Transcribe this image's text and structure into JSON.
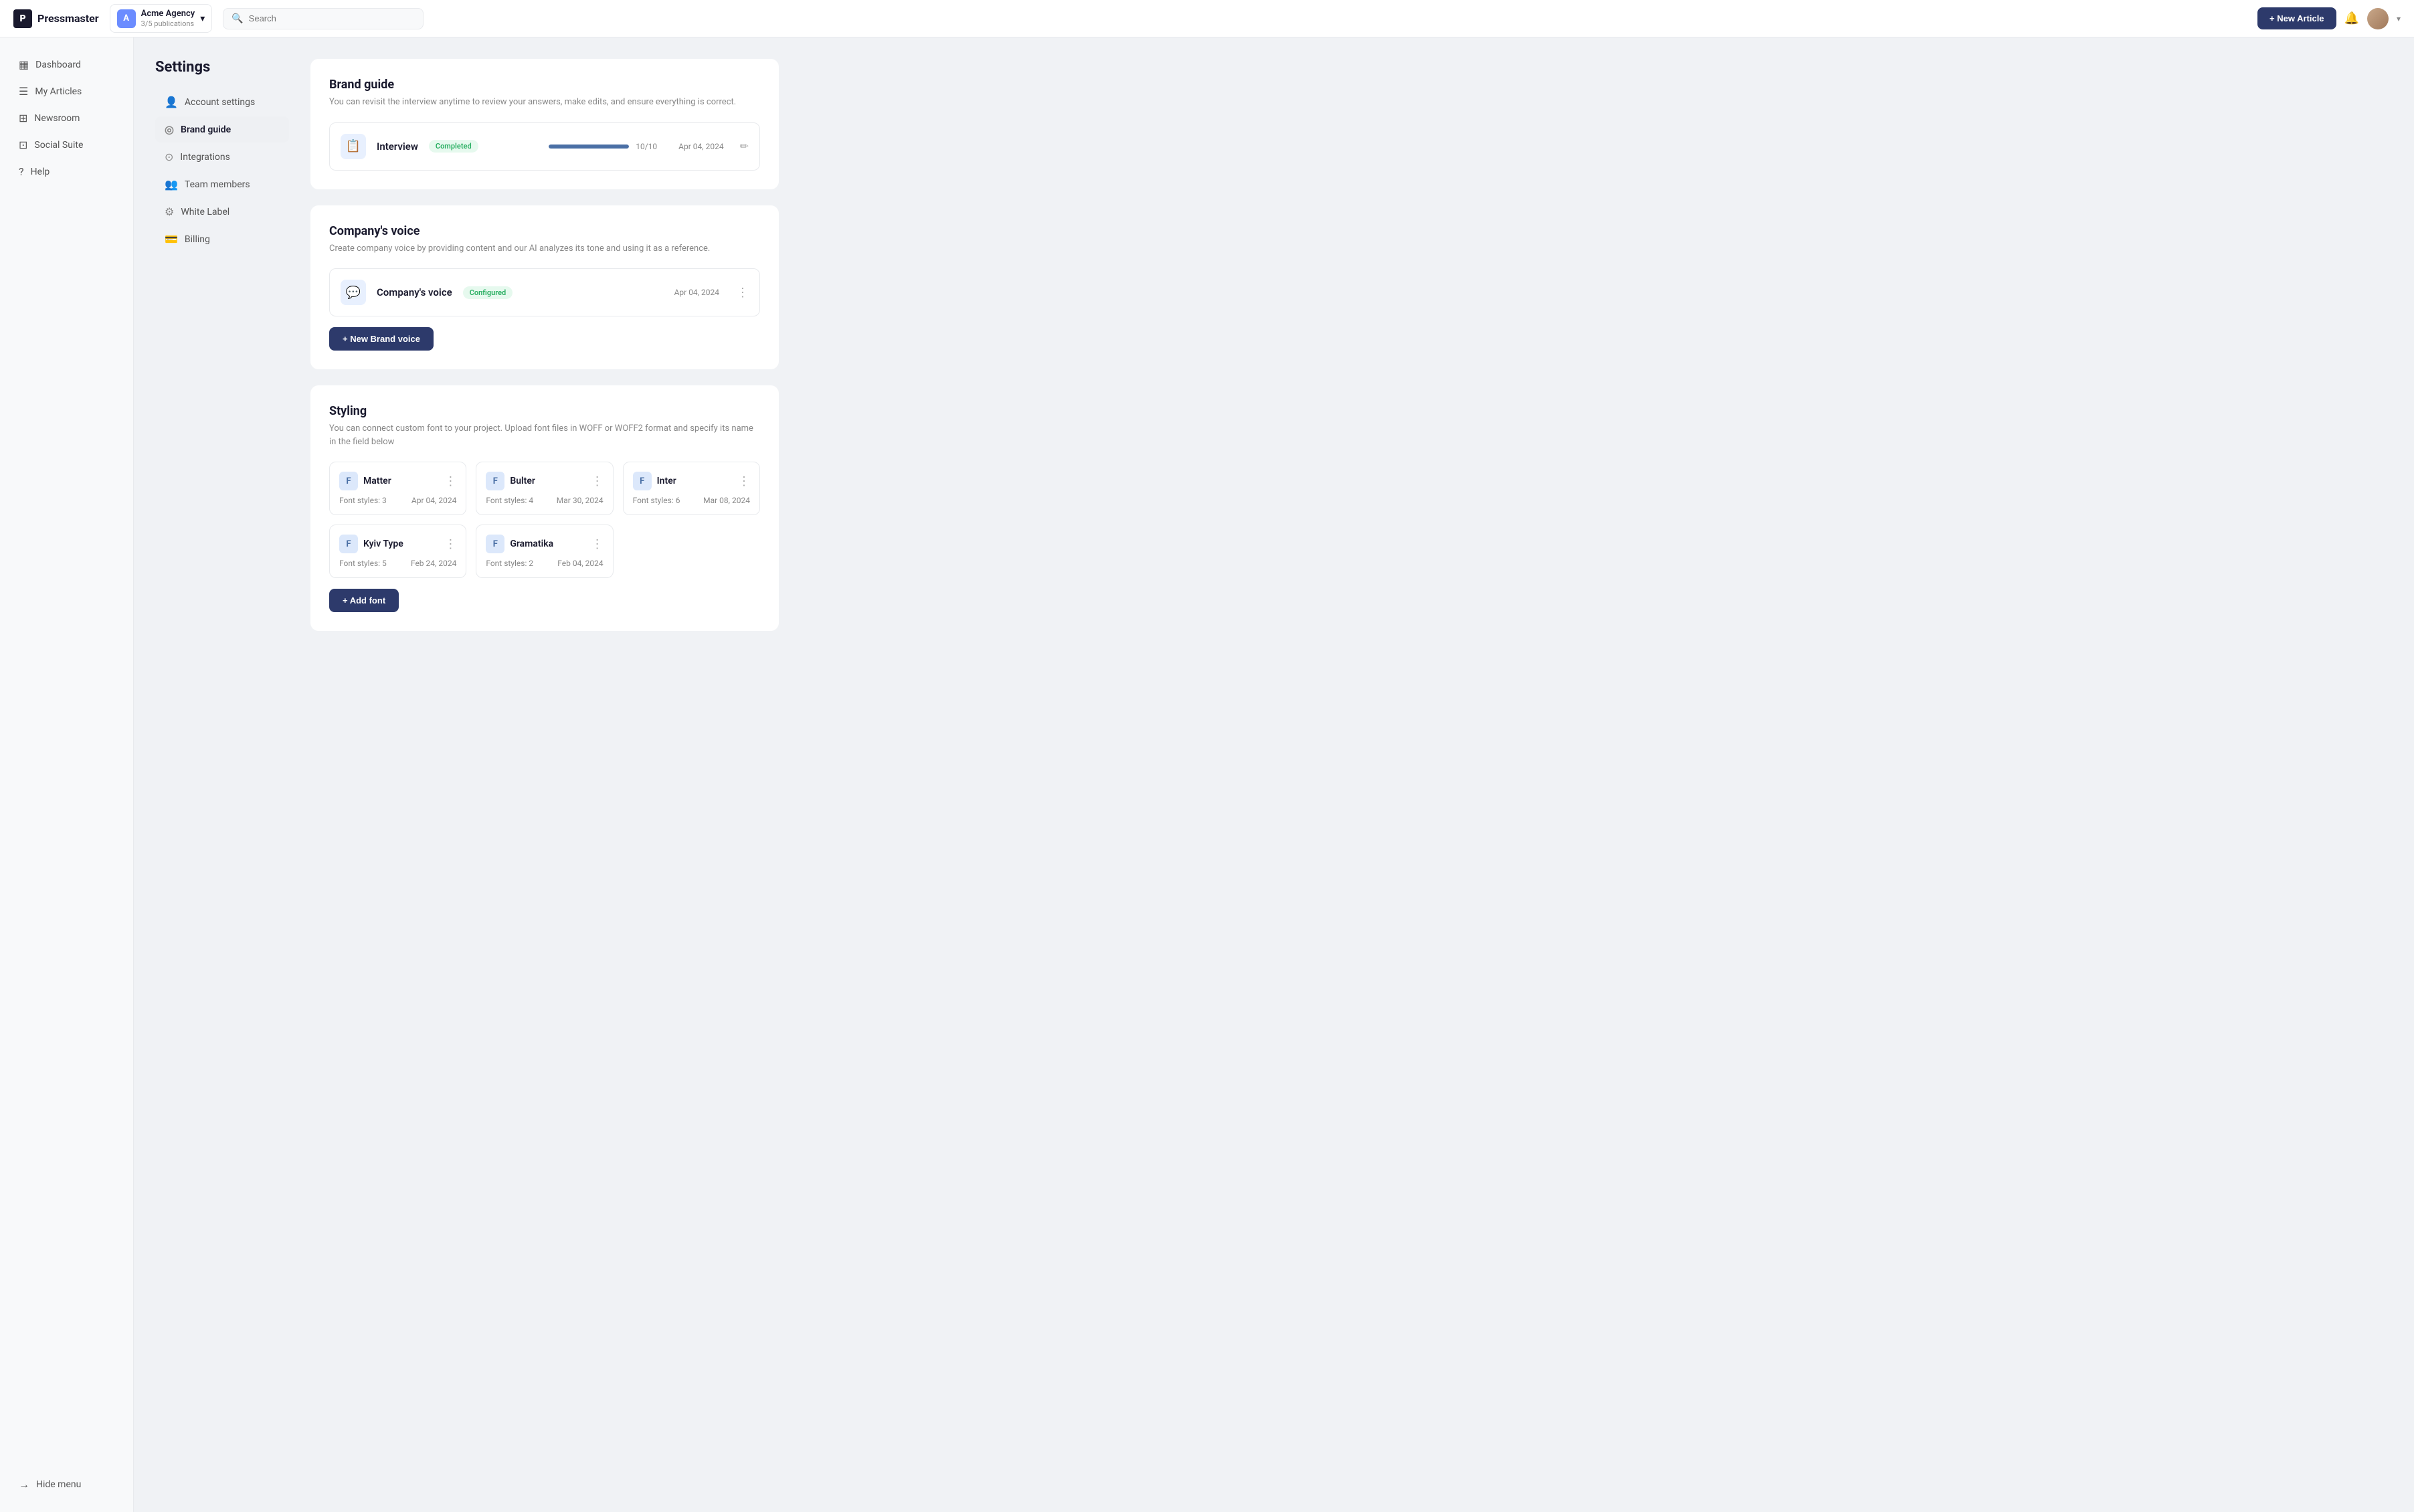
{
  "app": {
    "logo_letter": "P",
    "logo_name": "Pressmaster"
  },
  "workspace": {
    "avatar_letter": "A",
    "name": "Acme Agency",
    "sub": "3/5 publications",
    "chevron": "▾"
  },
  "search": {
    "placeholder": "Search"
  },
  "topnav": {
    "new_article_label": "+ New Article",
    "bell_icon": "🔔"
  },
  "sidebar": {
    "items": [
      {
        "id": "dashboard",
        "label": "Dashboard",
        "icon": "▦"
      },
      {
        "id": "my-articles",
        "label": "My Articles",
        "icon": "☰"
      },
      {
        "id": "newsroom",
        "label": "Newsroom",
        "icon": "⊞"
      },
      {
        "id": "social-suite",
        "label": "Social Suite",
        "icon": "⊡"
      },
      {
        "id": "help",
        "label": "Help",
        "icon": "?"
      }
    ],
    "bottom": [
      {
        "id": "hide-menu",
        "label": "Hide menu",
        "icon": "→"
      }
    ]
  },
  "settings": {
    "title": "Settings",
    "nav_items": [
      {
        "id": "account",
        "label": "Account settings",
        "icon": "👤"
      },
      {
        "id": "brand-guide",
        "label": "Brand guide",
        "icon": "◎",
        "active": true
      },
      {
        "id": "integrations",
        "label": "Integrations",
        "icon": "⊙"
      },
      {
        "id": "team-members",
        "label": "Team members",
        "icon": "👥"
      },
      {
        "id": "white-label",
        "label": "White Label",
        "icon": "⚙"
      },
      {
        "id": "billing",
        "label": "Billing",
        "icon": "💳"
      }
    ]
  },
  "brand_guide": {
    "title": "Brand guide",
    "description": "You can revisit the interview anytime to review your answers, make edits, and ensure everything is correct.",
    "interview": {
      "icon": "📋",
      "label": "Interview",
      "badge": "Completed",
      "progress_percent": 100,
      "progress_label": "10/10",
      "date": "Apr 04, 2024"
    }
  },
  "company_voice": {
    "title": "Company's voice",
    "description": "Create company voice by providing content and our AI analyzes its tone and using it as a reference.",
    "voice": {
      "icon": "💬",
      "label": "Company's voice",
      "badge": "Configured",
      "date": "Apr 04, 2024"
    },
    "new_voice_btn": "+ New Brand voice"
  },
  "styling": {
    "title": "Styling",
    "description": "You can connect custom font to your project. Upload font files in WOFF or WOFF2 format and specify its name in the field below",
    "fonts": [
      {
        "id": "matter",
        "name": "Matter",
        "styles": "Font styles: 3",
        "date": "Apr 04, 2024"
      },
      {
        "id": "bulter",
        "name": "Bulter",
        "styles": "Font styles: 4",
        "date": "Mar 30, 2024"
      },
      {
        "id": "inter",
        "name": "Inter",
        "styles": "Font styles: 6",
        "date": "Mar 08, 2024"
      },
      {
        "id": "kyiv-type",
        "name": "Kyiv Type",
        "styles": "Font styles: 5",
        "date": "Feb 24, 2024"
      },
      {
        "id": "gramatika",
        "name": "Gramatika",
        "styles": "Font styles: 2",
        "date": "Feb 04, 2024"
      }
    ],
    "add_font_btn": "+ Add font"
  }
}
